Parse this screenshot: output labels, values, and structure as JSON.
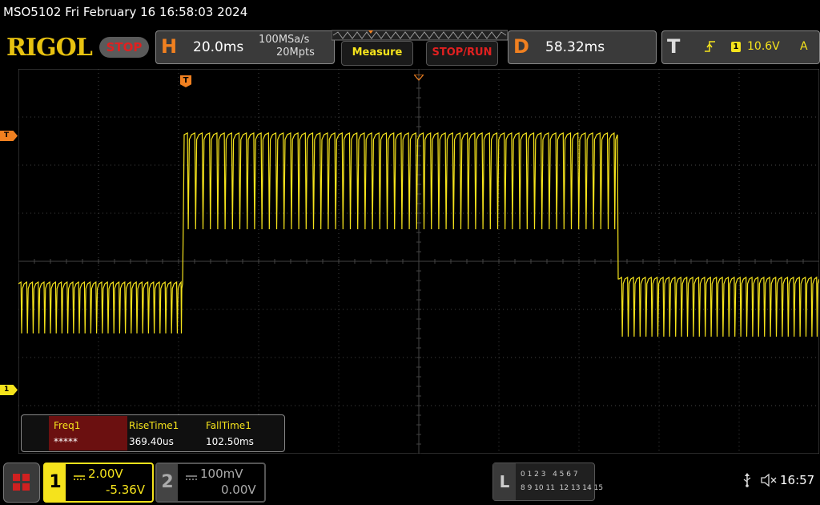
{
  "title_bar": {
    "text": "MSO5102  Fri February 16 16:58:03 2024"
  },
  "logo": "RIGOL",
  "run_state": "STOP",
  "horizontal": {
    "badge": "H",
    "timebase": "20.0ms",
    "sample_rate": "100MSa/s",
    "memory_depth": "20Mpts"
  },
  "buttons": {
    "measure": "Measure",
    "stop_run": "STOP/RUN"
  },
  "delay": {
    "badge": "D",
    "value": "58.32ms"
  },
  "trigger": {
    "badge": "T",
    "level_marker": "1",
    "level": "10.6V",
    "mode": "A"
  },
  "markers": {
    "trigger_pos": "T",
    "trigger_level": "T",
    "ch1_ground": "1"
  },
  "measurements": {
    "items": [
      {
        "label": "Freq1",
        "value": "*****"
      },
      {
        "label": "RiseTime1",
        "value": "369.40us"
      },
      {
        "label": "FallTime1",
        "value": "102.50ms"
      }
    ]
  },
  "channels": {
    "ch1": {
      "number": "1",
      "scale": "2.00V",
      "offset": "-5.36V"
    },
    "ch2": {
      "number": "2",
      "scale": "100mV",
      "offset": "0.00V"
    }
  },
  "logic": {
    "badge": "L",
    "row1": "0 1 2 3   4 5 6 7",
    "row2": "8 9 10 11  12 13 14 15"
  },
  "status": {
    "time": "16:57"
  },
  "colors": {
    "ch1": "#f5e31c",
    "accent_orange": "#f08020",
    "stop_red": "#e02020",
    "logo": "#e8c210"
  }
}
